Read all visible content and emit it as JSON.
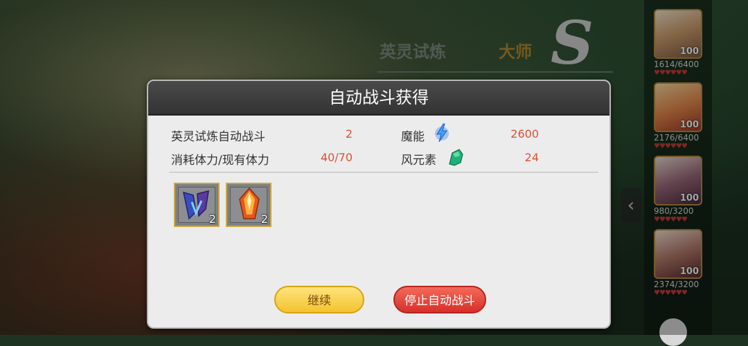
{
  "background": {
    "title_trial": "英灵试炼",
    "title_level": "大师",
    "rank_letter": "S"
  },
  "roster": [
    {
      "hp": "1614/6400",
      "level": "100"
    },
    {
      "hp": "2176/6400",
      "level": "100"
    },
    {
      "hp": "980/3200",
      "level": "100"
    },
    {
      "hp": "2374/3200",
      "level": "100"
    }
  ],
  "hearts": "♥♥♥♥♥♥",
  "side_arrow": "‹",
  "dialog": {
    "title": "自动战斗获得",
    "stats": {
      "auto_battle_label": "英灵试炼自动战斗",
      "auto_battle_value": "2",
      "stamina_label": "消耗体力/现有体力",
      "stamina_value": "40/70",
      "magic_label": "魔能",
      "magic_value": "2600",
      "wind_label": "风元素",
      "wind_value": "24"
    },
    "items": [
      {
        "icon": "blue-wing-fragment-icon",
        "count": "2"
      },
      {
        "icon": "fire-crystal-icon",
        "count": "2"
      }
    ],
    "continue_label": "继续",
    "stop_label": "停止自动战斗"
  },
  "colors": {
    "value_red": "#d9503a",
    "continue_bg": "#f3c430",
    "stop_bg": "#d6302a"
  }
}
